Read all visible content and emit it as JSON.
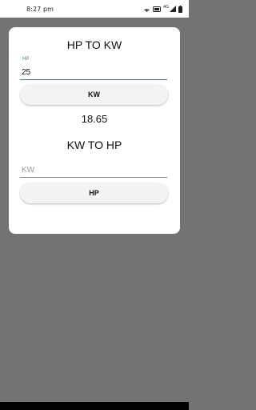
{
  "status_bar": {
    "time": "8:27 pm",
    "network": "4G"
  },
  "hp_to_kw": {
    "title": "HP TO KW",
    "input_label": "HP",
    "input_value": "25",
    "button_label": "KW",
    "result": "18.65"
  },
  "kw_to_hp": {
    "title": "KW TO HP",
    "input_placeholder": "KW",
    "input_value": "",
    "button_label": "HP"
  },
  "colors": {
    "accent": "#2e8b7a",
    "background": "#737373",
    "card": "#ffffff"
  }
}
